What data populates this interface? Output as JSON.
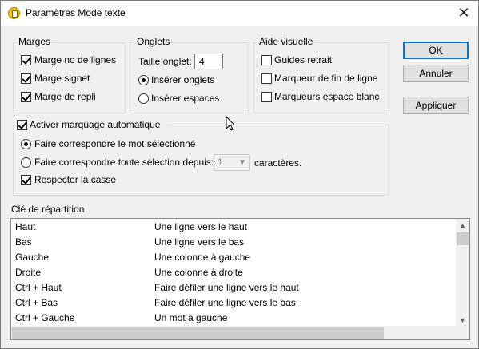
{
  "window": {
    "title": "Paramètres Mode texte",
    "close_glyph": "✕"
  },
  "margins": {
    "legend": "Marges",
    "items": [
      {
        "label": "Marge no de lignes",
        "checked": true
      },
      {
        "label": "Marge signet",
        "checked": true
      },
      {
        "label": "Marge de repli",
        "checked": true
      }
    ]
  },
  "tabs": {
    "legend": "Onglets",
    "tab_size_label": "Taille onglet:",
    "tab_size_value": "4",
    "options": [
      {
        "label": "Insérer onglets",
        "selected": true
      },
      {
        "label": "Insérer espaces",
        "selected": false
      }
    ]
  },
  "visual_aid": {
    "legend": "Aide visuelle",
    "items": [
      {
        "label": "Guides retrait",
        "checked": false
      },
      {
        "label": "Marqueur de fin de ligne",
        "checked": false
      },
      {
        "label": "Marqueurs espace blanc",
        "checked": false
      }
    ]
  },
  "auto_mark": {
    "legend": "Activer marquage automatique",
    "checked": true,
    "match_word_label": "Faire correspondre le mot sélectionné",
    "match_word_selected": true,
    "match_selection_label": "Faire correspondre toute sélection depuis:",
    "match_selection_selected": false,
    "chars_value": "1",
    "chars_suffix": "caractères.",
    "case_label": "Respecter la casse",
    "case_checked": true
  },
  "buttons": {
    "ok": "OK",
    "cancel": "Annuler",
    "apply": "Appliquer"
  },
  "keymap": {
    "label": "Clé de répartition",
    "rows": [
      {
        "key": "Haut",
        "action": "Une ligne vers le haut"
      },
      {
        "key": "Bas",
        "action": "Une ligne vers le bas"
      },
      {
        "key": "Gauche",
        "action": "Une colonne à gauche"
      },
      {
        "key": "Droite",
        "action": "Une colonne à droite"
      },
      {
        "key": "Ctrl + Haut",
        "action": "Faire défiler une ligne vers le haut"
      },
      {
        "key": "Ctrl + Bas",
        "action": "Faire défiler une ligne vers le bas"
      },
      {
        "key": "Ctrl + Gauche",
        "action": "Un mot à gauche"
      }
    ]
  },
  "colors": {
    "accent": "#0078d7",
    "app_icon": "#f2c200"
  }
}
